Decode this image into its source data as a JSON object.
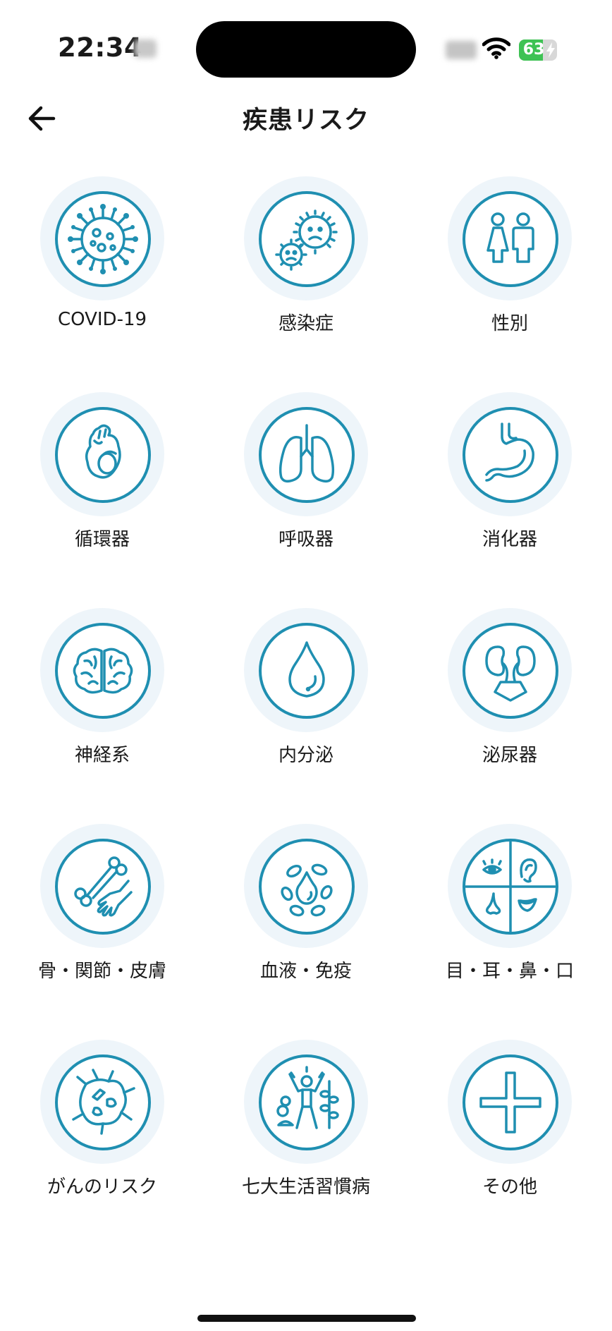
{
  "status_bar": {
    "time": "22:34",
    "battery_level": "63",
    "battery_fraction": 0.63
  },
  "header": {
    "title": "疾患リスク",
    "back_icon": "arrow-left-icon"
  },
  "categories": [
    {
      "label": "COVID-19",
      "icon": "virus-icon"
    },
    {
      "label": "感染症",
      "icon": "germs-icon"
    },
    {
      "label": "性別",
      "icon": "gender-icon"
    },
    {
      "label": "循環器",
      "icon": "heart-icon"
    },
    {
      "label": "呼吸器",
      "icon": "lungs-icon"
    },
    {
      "label": "消化器",
      "icon": "stomach-icon"
    },
    {
      "label": "神経系",
      "icon": "brain-icon"
    },
    {
      "label": "内分泌",
      "icon": "drop-icon"
    },
    {
      "label": "泌尿器",
      "icon": "kidneys-icon"
    },
    {
      "label": "骨・関節・皮膚",
      "icon": "bone-hand-icon"
    },
    {
      "label": "血液・免疫",
      "icon": "blood-cells-icon"
    },
    {
      "label": "目・耳・鼻・口",
      "icon": "senses-icon"
    },
    {
      "label": "がんのリスク",
      "icon": "cancer-cell-icon"
    },
    {
      "label": "七大生活習慣病",
      "icon": "lifestyle-icon"
    },
    {
      "label": "その他",
      "icon": "plus-icon"
    }
  ],
  "colors": {
    "accent": "#1f8fb1",
    "halo": "#eef5fa",
    "battery": "#3ec254"
  }
}
